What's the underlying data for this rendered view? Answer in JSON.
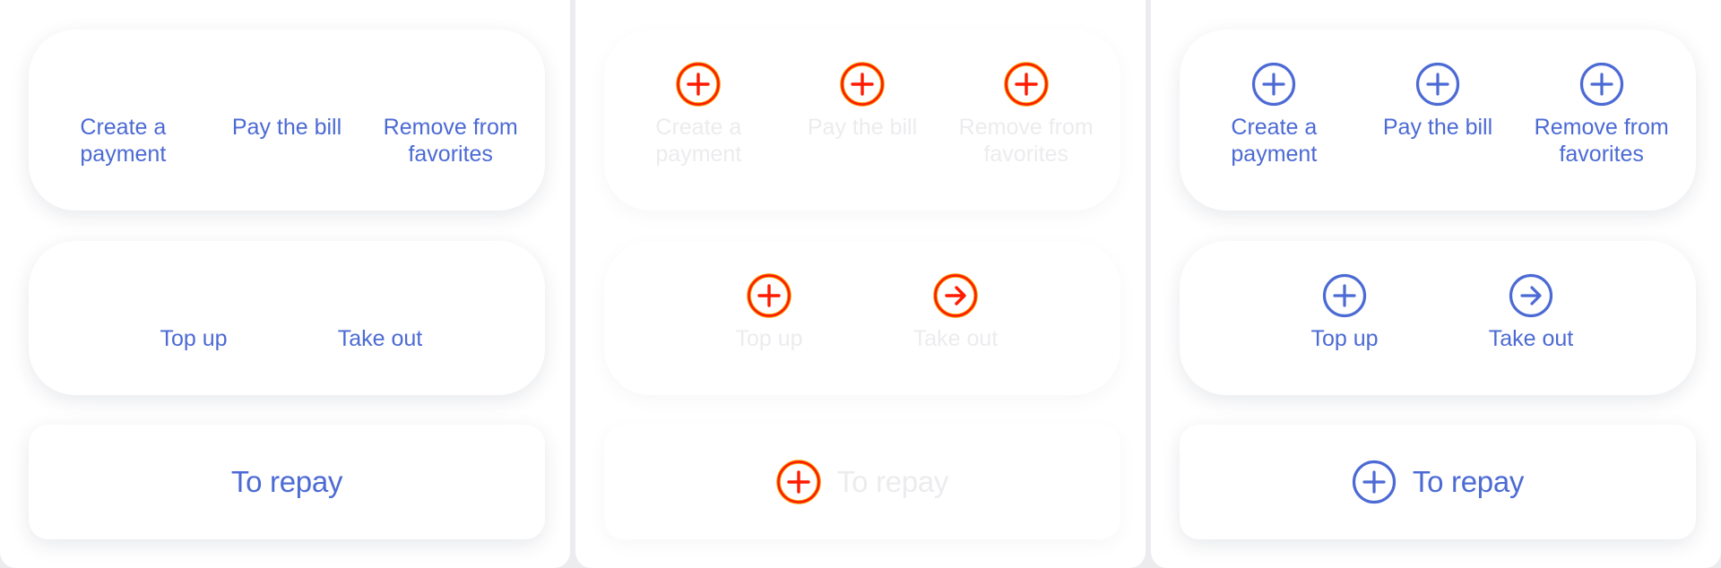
{
  "colors": {
    "accent": "#4c6ad4",
    "highlight_icon": "#ff1a00",
    "faded_text": "#ececef",
    "background": "#ececef"
  },
  "payment_actions": {
    "create_payment": "Create a\npayment",
    "pay_bill": "Pay the bill",
    "remove_favorites": "Remove from\nfavorites"
  },
  "account_actions": {
    "top_up": "Top up",
    "take_out": "Take out"
  },
  "repay": {
    "label": "To repay"
  },
  "icons": {
    "plus": "plus-circle-icon",
    "arrow": "arrow-right-circle-icon"
  }
}
